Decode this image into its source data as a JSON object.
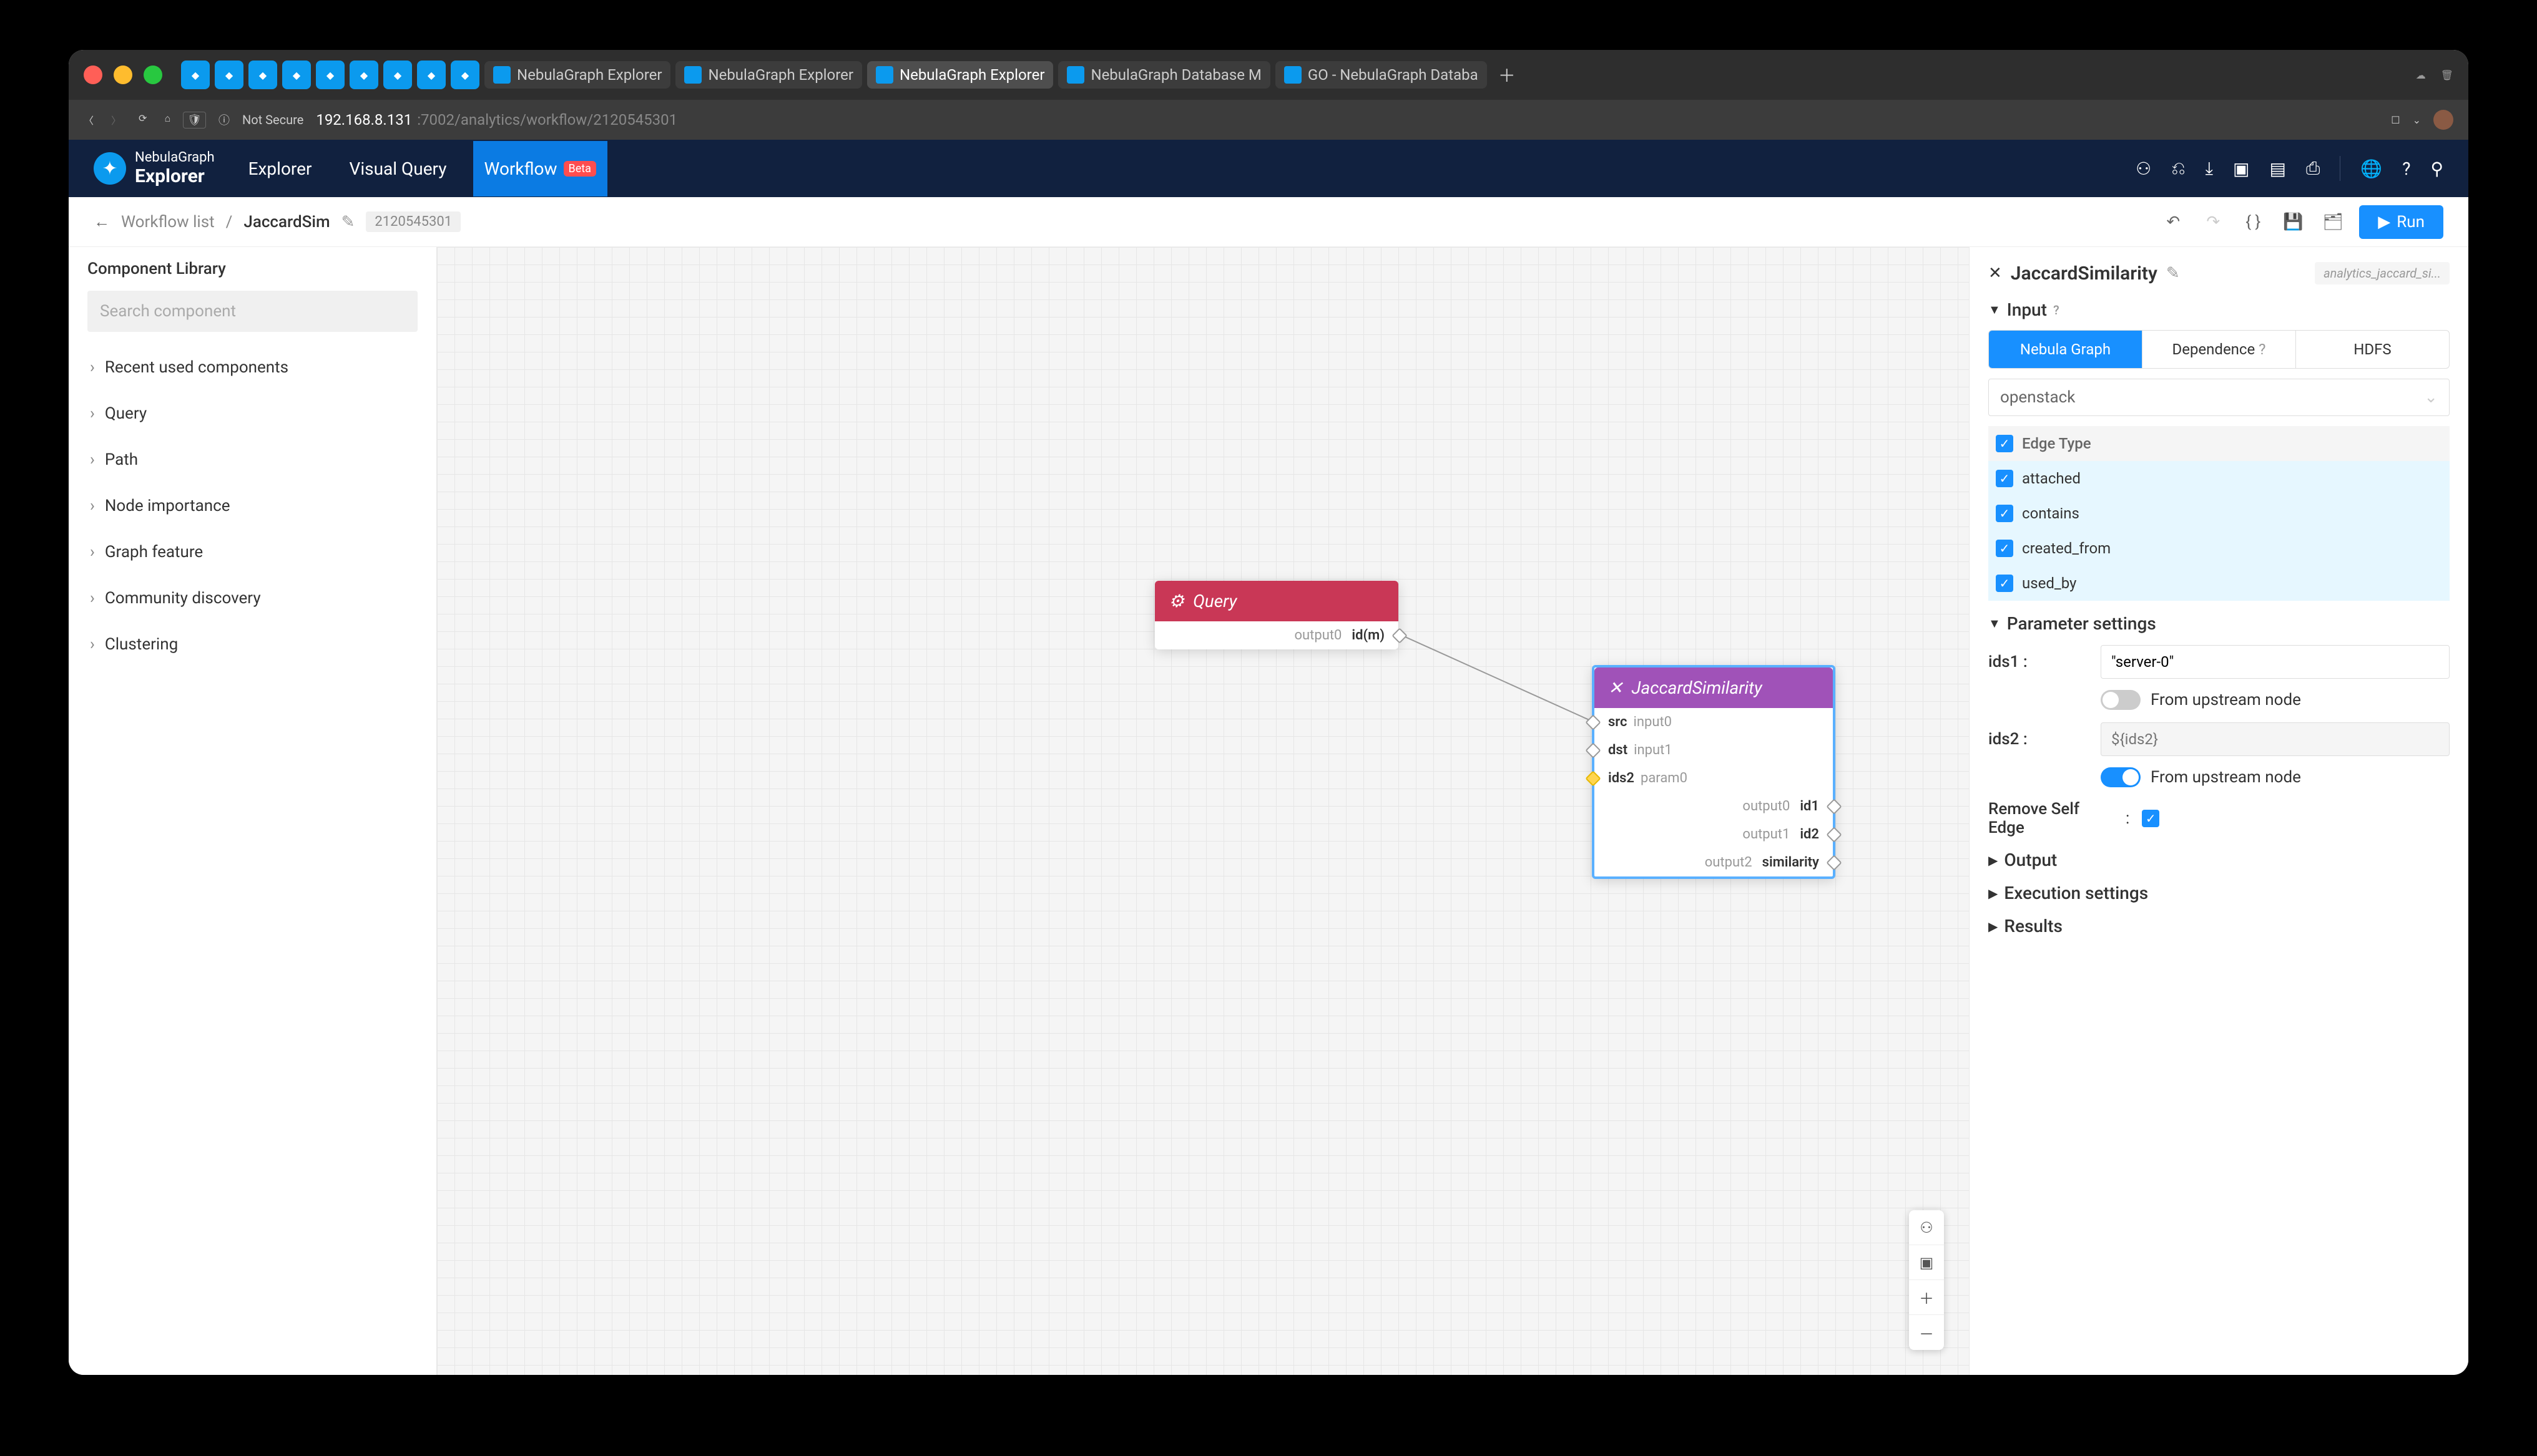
{
  "browser": {
    "tabs": [
      {
        "label": "NebulaGraph Explorer"
      },
      {
        "label": "NebulaGraph Explorer"
      },
      {
        "label": "NebulaGraph Explorer",
        "active": true
      },
      {
        "label": "NebulaGraph Database M"
      },
      {
        "label": "GO - NebulaGraph Databa"
      }
    ],
    "url_host": "192.168.8.131",
    "url_path": ":7002/analytics/workflow/2120545301",
    "not_secure": "Not Secure"
  },
  "app": {
    "brand_top": "NebulaGraph",
    "brand_bottom": "Explorer",
    "nav": {
      "explorer": "Explorer",
      "visual_query": "Visual Query",
      "workflow": "Workflow",
      "beta": "Beta"
    }
  },
  "breadcrumb": {
    "workflow_list": "Workflow list",
    "sep": "/",
    "name": "JaccardSim",
    "id": "2120545301",
    "run": "Run"
  },
  "leftbar": {
    "title": "Component Library",
    "search_placeholder": "Search component",
    "items": [
      "Recent used components",
      "Query",
      "Path",
      "Node importance",
      "Graph feature",
      "Community discovery",
      "Clustering"
    ]
  },
  "canvas": {
    "query_node": {
      "title": "Query",
      "out_label": "output0",
      "out_value": "id(m)"
    },
    "jaccard_node": {
      "title": "JaccardSimilarity",
      "inputs": [
        {
          "name": "src",
          "hint": "input0"
        },
        {
          "name": "dst",
          "hint": "input1"
        },
        {
          "name": "ids2",
          "hint": "param0"
        }
      ],
      "outputs": [
        {
          "label": "output0",
          "val": "id1"
        },
        {
          "label": "output1",
          "val": "id2"
        },
        {
          "label": "output2",
          "val": "similarity"
        }
      ]
    }
  },
  "rightpanel": {
    "title": "JaccardSimilarity",
    "badge": "analytics_jaccard_si...",
    "input_h": "Input",
    "tabs": {
      "nebula": "Nebula Graph",
      "dependence": "Dependence",
      "hdfs": "HDFS"
    },
    "space": "openstack",
    "edge_type": "Edge Type",
    "edges": [
      "attached",
      "contains",
      "created_from",
      "used_by"
    ],
    "param_h": "Parameter settings",
    "ids1_label": "ids1 :",
    "ids1_val": "\"server-0\"",
    "ids2_label": "ids2 :",
    "ids2_placeholder": "${ids2}",
    "upstream": "From upstream node",
    "remove_self_label": "Remove Self Edge",
    "colon": ":",
    "output_h": "Output",
    "exec_h": "Execution settings",
    "results_h": "Results"
  }
}
